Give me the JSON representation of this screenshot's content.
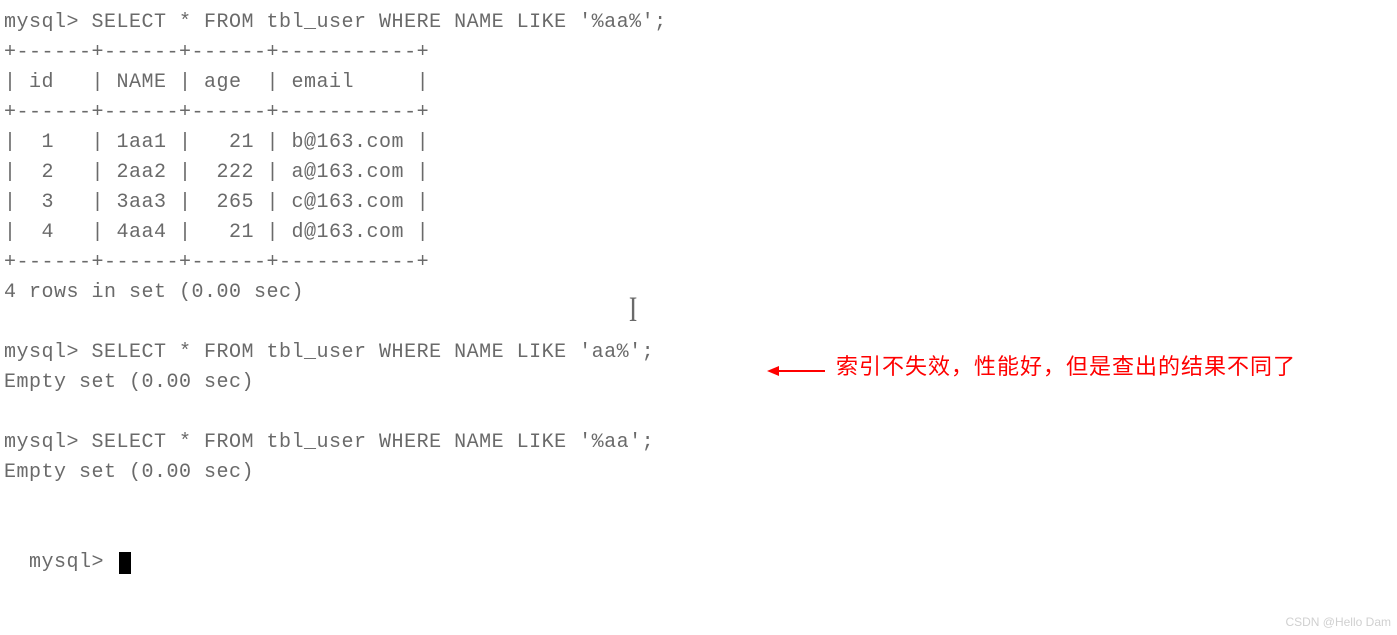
{
  "terminal": {
    "prompt": "mysql>",
    "query1": "mysql> SELECT * FROM tbl_user WHERE NAME LIKE '%aa%';",
    "table": {
      "border_top": "+------+------+------+-----------+",
      "header": "| id   | NAME | age  | email     |",
      "border_mid": "+------+------+------+-----------+",
      "rows": [
        "|  1   | 1aa1 |   21 | b@163.com |",
        "|  2   | 2aa2 |  222 | a@163.com |",
        "|  3   | 3aa3 |  265 | c@163.com |",
        "|  4   | 4aa4 |   21 | d@163.com |"
      ],
      "border_bot": "+------+------+------+-----------+"
    },
    "result1": "4 rows in set (0.00 sec)",
    "query2": "mysql> SELECT * FROM tbl_user WHERE NAME LIKE 'aa%';",
    "result2": "Empty set (0.00 sec)",
    "query3": "mysql> SELECT * FROM tbl_user WHERE NAME LIKE '%aa';",
    "result3": "Empty set (0.00 sec)",
    "prompt_final": "mysql> "
  },
  "annotation": {
    "text": "索引不失效，性能好，但是查出的结果不同了"
  },
  "cursor_glyph": "I",
  "watermark": "CSDN @Hello Dam"
}
